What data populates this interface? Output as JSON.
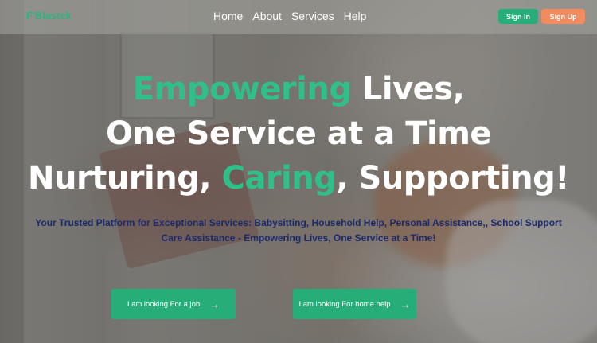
{
  "navbar": {
    "logo": "F'Blastek",
    "links": [
      "Home",
      "About",
      "Services",
      "Help"
    ],
    "signin_label": "Sign In",
    "signup_label": "Sign Up"
  },
  "hero": {
    "line1_highlight": "Empowering",
    "line1_rest": " Lives,",
    "line2": "One Service at a Time",
    "line3_start": "Nurturing, ",
    "line3_highlight": "Caring",
    "line3_end": ", Supporting!",
    "subtitle_line1": "Your Trusted Platform for Exceptional Services: Babysitting, Household Help, Personal Assistance,, School Support",
    "subtitle_line2": "Care Assistance - Empowering Lives, One Service at a Time!",
    "cta_job_label": "I am looking For a job",
    "cta_help_label": "I am looking For home help",
    "arrow_icon": "arrow-right-icon"
  },
  "colors": {
    "accent_green": "#2fbf88",
    "button_green": "#27ae78",
    "signup_orange": "#f28b5e",
    "subtitle_navy": "#1b2a6b"
  }
}
